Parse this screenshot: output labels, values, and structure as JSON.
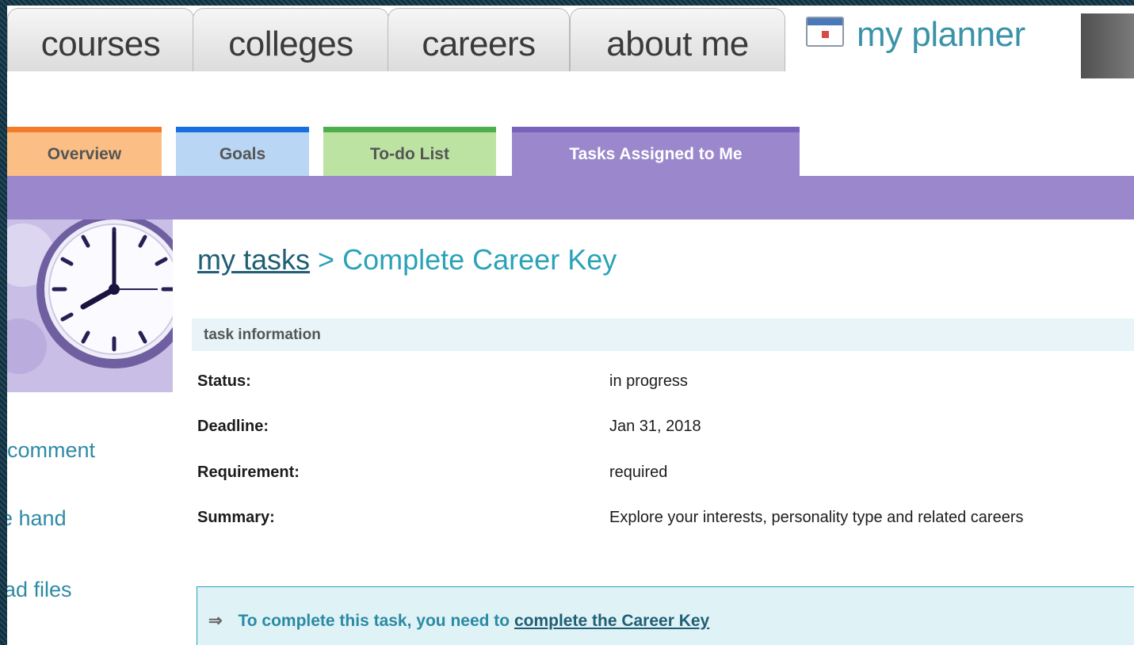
{
  "main_tabs": [
    {
      "label": "courses"
    },
    {
      "label": "colleges"
    },
    {
      "label": "careers"
    },
    {
      "label": "about me"
    },
    {
      "label": "my planner",
      "icon": "calendar-icon",
      "active": true
    }
  ],
  "sub_tabs": [
    {
      "label": "Overview",
      "color": "#fbbf86",
      "accent": "#f47b2a"
    },
    {
      "label": "Goals",
      "color": "#b9d6f5",
      "accent": "#1a6fe0"
    },
    {
      "label": "To-do List",
      "color": "#bde3a3",
      "accent": "#4caf4c"
    },
    {
      "label": "Tasks Assigned to Me",
      "color": "#9b88cc",
      "accent": "#7a62bc",
      "active": true
    }
  ],
  "sidebar": {
    "image": "clock-image",
    "links": [
      {
        "label": "comment"
      },
      {
        "label": "e hand"
      },
      {
        "label": "ad files"
      }
    ]
  },
  "breadcrumb": {
    "parent": "my tasks",
    "separator": ">",
    "current": "Complete Career Key"
  },
  "task_info": {
    "header": "task information",
    "rows": [
      {
        "label": "Status:",
        "value": "in progress"
      },
      {
        "label": "Deadline:",
        "value": "Jan 31, 2018"
      },
      {
        "label": "Requirement:",
        "value": "required"
      },
      {
        "label": "Summary:",
        "value": "Explore your interests, personality type and related careers"
      }
    ]
  },
  "callout": {
    "arrow": "⇒",
    "text": "To complete this task, you need to",
    "link": "complete the Career Key"
  },
  "colors": {
    "accent_teal": "#2aa2b8",
    "link_dark": "#1f5e74",
    "purple_bar": "#9b88cc"
  }
}
